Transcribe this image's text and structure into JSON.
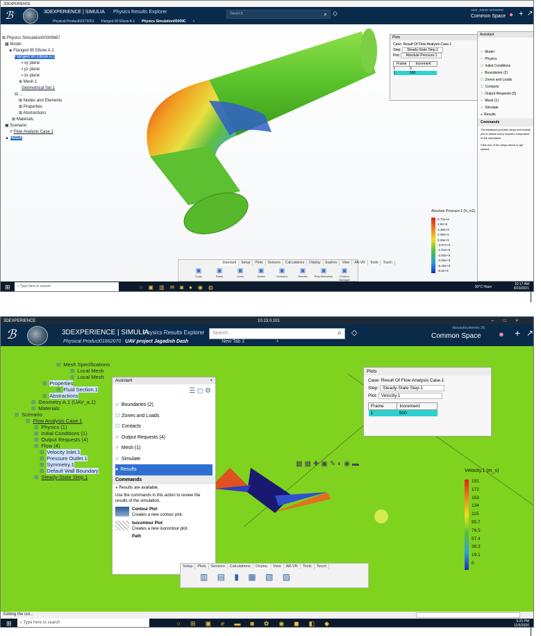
{
  "shot1": {
    "window_title": "3DEXPERIENCE",
    "brand": "3DEXPERIENCE | SIMULIA",
    "app_name": "Physics Results Explorer",
    "search_placeholder": "Search",
    "user_line": "user_name someone",
    "space": "Common Space",
    "tabs": [
      "Physical Product01573201",
      "Flanged 90 Elbow A.1",
      "Physics Simulation00009C"
    ],
    "tree": [
      "Physics Simulation00009867",
      "Model",
      "Flanged 90 Elbow A.1",
      "Flanged 90 Elbow A.1",
      "xy plane",
      "yz plane",
      "zx plane",
      "Mesh.1",
      "Geometrical Set.1",
      "...",
      "Nodes and Elements",
      "Properties",
      "Abstractions",
      "Materials",
      "Scenario",
      "Flow Analysis Case.1",
      "Result"
    ],
    "plots": {
      "title": "Plots",
      "case_label": "Case:",
      "case": "Result Of Flow Analysis Case.1",
      "step_label": "Step:",
      "step": "Steady-State Step.1",
      "plot_label": "Plot:",
      "plot": "Absolute Pressure.1",
      "frame_header": "Frame",
      "increment_header": "Increment",
      "row1": [
        "1",
        "0"
      ],
      "row2": [
        "1",
        "500"
      ]
    },
    "assistant": {
      "title": "Assistant",
      "items": [
        "Model",
        "Physics",
        "Initial Conditions",
        "Boundaries (2)",
        "Zones and Loads",
        "Contacts",
        "Output Requests (5)",
        "Mesh (1)",
        "Simulate",
        "Results"
      ],
      "commands_title": "Commands",
      "help1": "The Assistant provides steps that enable you to define every required component of the simulation.",
      "help2": "Click one of the steps above to get started."
    },
    "legend": {
      "title": "Absolute Pressure.1 (N_m2)",
      "values": [
        "5.72e+6",
        "4.8e+6",
        "3.39e+6",
        "2.08e+6",
        "8.55e+5",
        "-3.97e+5",
        "-1.61e+6",
        "-2.83e+6",
        "-4.05e+6",
        "-5.28e+6",
        "-6.5e+6"
      ]
    },
    "ribbon_tabs": [
      "Standard",
      "Setup",
      "Plots",
      "Sensors",
      "Calculations",
      "Display",
      "Explore",
      "View",
      "AR-VR",
      "Tools",
      "Touch"
    ],
    "ribbon_buttons": [
      "Copy",
      "Paste",
      "Undo",
      "Model",
      "Scenario",
      "Results",
      "Play Animation",
      "Feature Manager"
    ],
    "taskbar_search": "Type here to search",
    "tray": "30°C Haze",
    "time": "10:17 AM",
    "date": "9/23/2021"
  },
  "shot2": {
    "window_title": "3DEXPERIENCE",
    "ip": "10.13.0.101",
    "brand": "3DEXPERIENCE | SIMULIA",
    "app_name": "Physics Results Explorer",
    "search_placeholder": "Search",
    "user_line": "dassaultsystemes 3S",
    "space": "Common Space",
    "tabs": [
      "Physical Product01662070",
      "UAV project Jagadish Dash",
      "New Tab 2"
    ],
    "tree": [
      "Mesh Specifications",
      "Local Mesh",
      "Local Mesh",
      "Properties",
      "Fluid Section.1",
      "Abstractions",
      "Geometry A.1 (UAV_a.1)",
      "Materials",
      "Scenario",
      "Flow Analysis Case.1",
      "Physics (1)",
      "Initial Conditions (1)",
      "Output Requests (4)",
      "Flow (4)",
      "Velocity Inlet.1",
      "Pressure Outlet.1",
      "Symmetry.1",
      "Default Wall Boundary",
      "Steady-State Step.1"
    ],
    "assistant": {
      "title": "Assistant",
      "items": [
        "Boundaries (2)",
        "Zones and Loads",
        "Contacts",
        "Output Requests (4)",
        "Mesh (1)",
        "Simulate",
        "Results"
      ],
      "commands_title": "Commands",
      "available": "Results are available.",
      "use": "Use the commands in this action to review the results of the simulation.",
      "cmd1_title": "Contour Plot",
      "cmd1_desc": "Creates a new contour plot.",
      "cmd2_title": "Isocontour Plot",
      "cmd2_desc": "Creates a new isocontour plot.",
      "cmd3_title": "Path"
    },
    "plots": {
      "title": "Plots",
      "case_label": "Case:",
      "case": "Result Of Flow Analysis Case.1",
      "step_label": "Step:",
      "step": "Steady-State Step.1",
      "plot_label": "Plot:",
      "plot": "Velocity.1",
      "frame_header": "Frame",
      "increment_header": "Increment",
      "row": [
        "1",
        "500"
      ]
    },
    "legend": {
      "title": "Velocity.1 (m_s)",
      "values": [
        "191",
        "172",
        "153",
        "134",
        "115",
        "95.7",
        "76.5",
        "57.4",
        "38.3",
        "19.1",
        "0"
      ]
    },
    "ribbon_tabs": [
      "Setup",
      "Plots",
      "Sensors",
      "Calculations",
      "Display",
      "View",
      "AR-VR",
      "Tools",
      "Touch"
    ],
    "status": "Editing the cut...",
    "taskbar_search": "Type here to search",
    "time": "5:25 PM",
    "date": "11/5/2020"
  }
}
